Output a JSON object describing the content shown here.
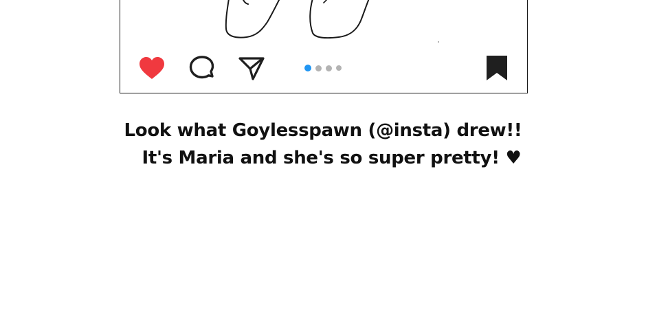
{
  "post": {
    "actions": {
      "like_icon": "heart-icon",
      "like_color": "#f0393f",
      "comment_icon": "comment-bubble-icon",
      "share_icon": "paper-plane-icon",
      "save_icon": "bookmark-icon"
    },
    "carousel": {
      "total": 4,
      "active_index": 0,
      "active_color": "#2196f3",
      "inactive_color": "#b3b3b3"
    }
  },
  "caption": {
    "line1": "Look what Goylesspawn (@insta) drew!!",
    "line2": "It's Maria and she's so super pretty! ♥"
  }
}
